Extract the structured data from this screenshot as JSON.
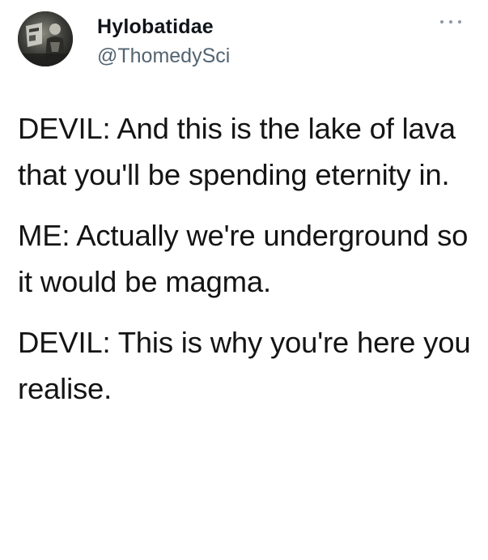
{
  "tweet": {
    "author": {
      "display_name": "Hylobatidae",
      "handle": "@ThomedySci",
      "avatar_icon": "profile-photo"
    },
    "more_icon": "more-options-icon",
    "paragraphs": [
      "DEVIL: And this is the lake of lava that you'll be spending eternity in.",
      "ME: Actually we're underground so it would be magma.",
      "DEVIL: This is why you're here you realise."
    ]
  }
}
